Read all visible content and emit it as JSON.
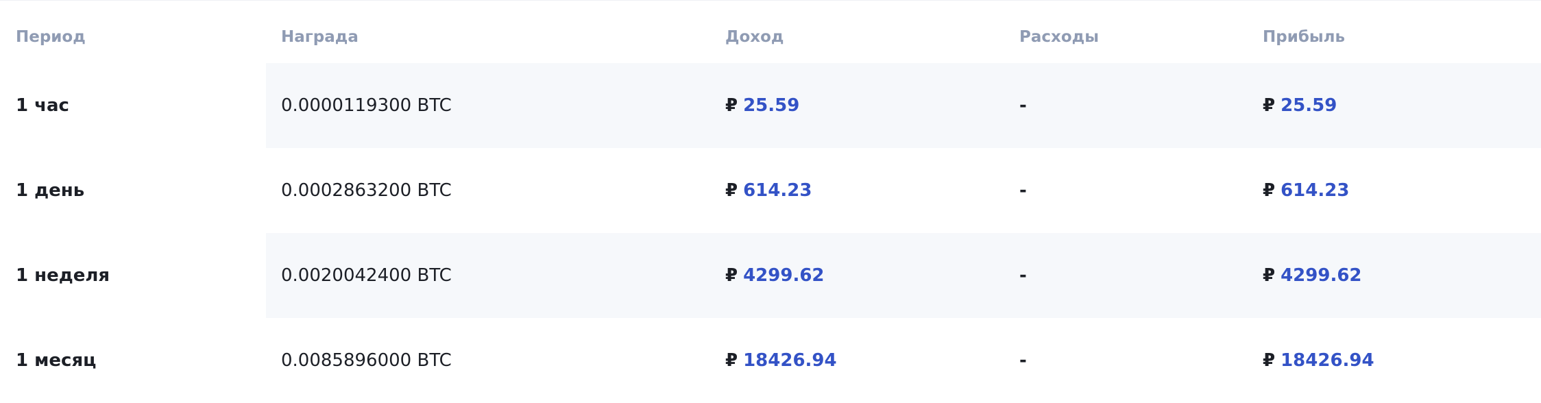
{
  "table": {
    "headers": {
      "period": "Период",
      "reward": "Награда",
      "income": "Доход",
      "expense": "Расходы",
      "profit": "Прибыль"
    },
    "currency_symbol": "₽",
    "rows": [
      {
        "period": "1 час",
        "reward": "0.0000119300 BTC",
        "income": "25.59",
        "expense": "-",
        "profit": "25.59"
      },
      {
        "period": "1 день",
        "reward": "0.0002863200 BTC",
        "income": "614.23",
        "expense": "-",
        "profit": "614.23"
      },
      {
        "period": "1 неделя",
        "reward": "0.0020042400 BTC",
        "income": "4299.62",
        "expense": "-",
        "profit": "4299.62"
      },
      {
        "period": "1 месяц",
        "reward": "0.0085896000 BTC",
        "income": "18426.94",
        "expense": "-",
        "profit": "18426.94"
      }
    ],
    "colors": {
      "header_text": "#8f9bb3",
      "body_text": "#1c1f26",
      "money_accent": "#3352c6",
      "row_band": "#f6f8fb"
    }
  }
}
